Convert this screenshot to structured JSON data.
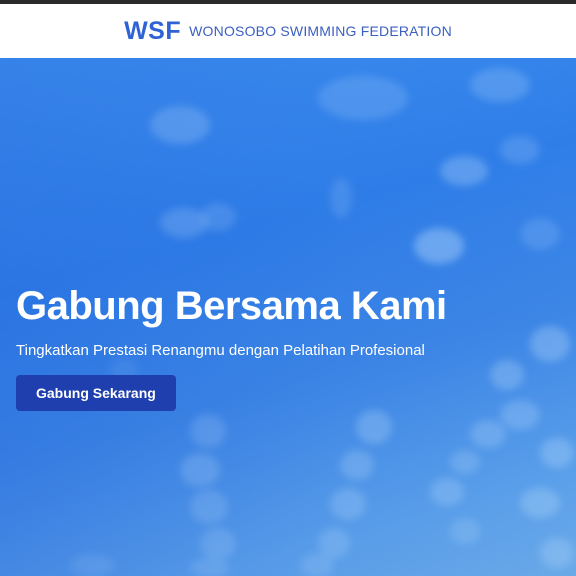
{
  "header": {
    "logo_text": "WSF",
    "org_name": "WONOSOBO SWIMMING FEDERATION"
  },
  "hero": {
    "title": "Gabung Bersama Kami",
    "subtitle": "Tingkatkan Prestasi Renangmu dengan Pelatihan Profesional",
    "cta_label": "Gabung Sekarang",
    "background_image": "underwater-pool-lane-bokeh"
  },
  "colors": {
    "brand": "#2f63d3",
    "hero_blue": "#3d8ff0",
    "cta_background": "#1f3fae",
    "top_border": "#2b2b2b"
  }
}
